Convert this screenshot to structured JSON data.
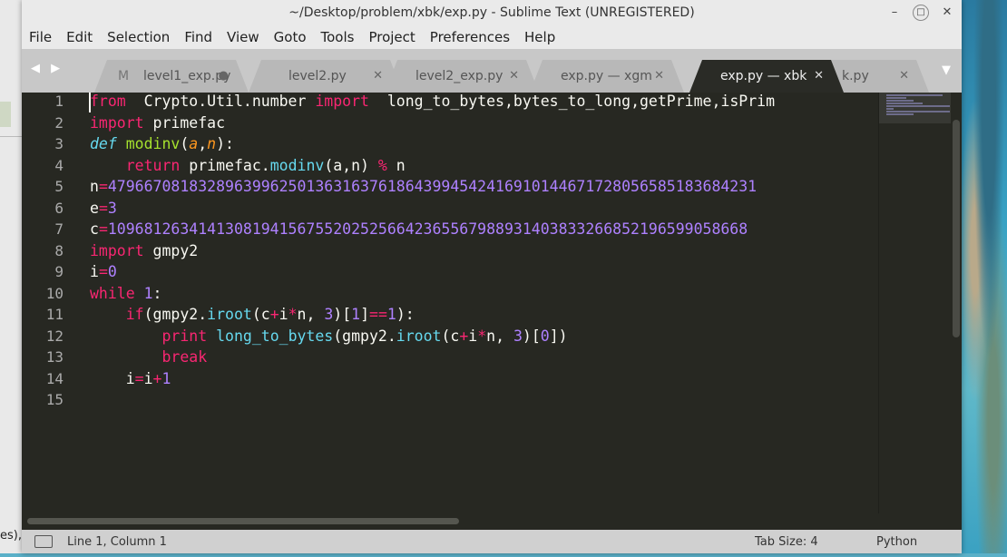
{
  "window": {
    "title": "~/Desktop/problem/xbk/exp.py - Sublime Text (UNREGISTERED)",
    "controls": {
      "minimize": "–",
      "maximize": "□",
      "close": "✕"
    }
  },
  "menu": [
    "File",
    "Edit",
    "Selection",
    "Find",
    "View",
    "Goto",
    "Tools",
    "Project",
    "Preferences",
    "Help"
  ],
  "tabs": {
    "nav": "◀ ▶",
    "overflow": "▼",
    "items": [
      {
        "label": "level1_exp.py",
        "close": "●",
        "prefix": "M"
      },
      {
        "label": "level2.py",
        "close": "✕"
      },
      {
        "label": "level2_exp.py",
        "close": "✕"
      },
      {
        "label": "exp.py — xgm",
        "close": "✕"
      },
      {
        "label": "exp.py — xbk",
        "close": "✕",
        "active": true
      },
      {
        "label": "k.py",
        "close": "✕"
      }
    ]
  },
  "editor": {
    "line_numbers": [
      "1",
      "2",
      "3",
      "4",
      "5",
      "6",
      "7",
      "8",
      "9",
      "10",
      "11",
      "12",
      "13",
      "14",
      "15"
    ],
    "lines": [
      [
        [
          "kw",
          "from"
        ],
        [
          "",
          "  Crypto.Util.number "
        ],
        [
          "kw",
          "import"
        ],
        [
          "",
          "  long_to_bytes,bytes_to_long,getPrime,isPrim"
        ]
      ],
      [
        [
          "kw",
          "import"
        ],
        [
          "",
          " primefac"
        ]
      ],
      [
        [
          "sf",
          "def"
        ],
        [
          "",
          " "
        ],
        [
          "fn",
          "modinv"
        ],
        [
          "",
          "("
        ],
        [
          "pa",
          "a"
        ],
        [
          "",
          ","
        ],
        [
          "pa",
          "n"
        ],
        [
          "",
          "):"
        ]
      ],
      [
        [
          "",
          "    "
        ],
        [
          "kw",
          "return"
        ],
        [
          "",
          " primefac."
        ],
        [
          "bf",
          "modinv"
        ],
        [
          "",
          "(a,n) "
        ],
        [
          "op",
          "%"
        ],
        [
          "",
          " n"
        ]
      ],
      [
        [
          "",
          "n"
        ],
        [
          "op",
          "="
        ],
        [
          "nu",
          "479667081832896399625013631637618643994542416910144671728056585183684231"
        ]
      ],
      [
        [
          "",
          "e"
        ],
        [
          "op",
          "="
        ],
        [
          "nu",
          "3"
        ]
      ],
      [
        [
          "",
          "c"
        ],
        [
          "op",
          "="
        ],
        [
          "nu",
          "10968126341413081941567552025256642365567988931403833266852196599058668"
        ]
      ],
      [
        [
          "kw",
          "import"
        ],
        [
          "",
          " gmpy2"
        ]
      ],
      [
        [
          "",
          "i"
        ],
        [
          "op",
          "="
        ],
        [
          "nu",
          "0"
        ]
      ],
      [
        [
          "kw",
          "while"
        ],
        [
          "",
          " "
        ],
        [
          "nu",
          "1"
        ],
        [
          "",
          ":"
        ]
      ],
      [
        [
          "",
          "    "
        ],
        [
          "kw",
          "if"
        ],
        [
          "",
          "(gmpy2."
        ],
        [
          "bf",
          "iroot"
        ],
        [
          "",
          "(c"
        ],
        [
          "op",
          "+"
        ],
        [
          "",
          "i"
        ],
        [
          "op",
          "*"
        ],
        [
          "",
          "n, "
        ],
        [
          "nu",
          "3"
        ],
        [
          "",
          ")["
        ],
        [
          "nu",
          "1"
        ],
        [
          "",
          "]"
        ],
        [
          "op",
          "=="
        ],
        [
          "nu",
          "1"
        ],
        [
          "",
          "):"
        ]
      ],
      [
        [
          "",
          "        "
        ],
        [
          "kw",
          "print"
        ],
        [
          "",
          " "
        ],
        [
          "bf",
          "long_to_bytes"
        ],
        [
          "",
          "(gmpy2."
        ],
        [
          "bf",
          "iroot"
        ],
        [
          "",
          "(c"
        ],
        [
          "op",
          "+"
        ],
        [
          "",
          "i"
        ],
        [
          "op",
          "*"
        ],
        [
          "",
          "n, "
        ],
        [
          "nu",
          "3"
        ],
        [
          "",
          ")["
        ],
        [
          "nu",
          "0"
        ],
        [
          "",
          "])"
        ]
      ],
      [
        [
          "",
          "        "
        ],
        [
          "kw",
          "break"
        ]
      ],
      [
        [
          "",
          "    i"
        ],
        [
          "op",
          "="
        ],
        [
          "",
          "i"
        ],
        [
          "op",
          "+"
        ],
        [
          "nu",
          "1"
        ]
      ],
      [
        [
          "",
          ""
        ]
      ]
    ]
  },
  "status": {
    "position": "Line 1, Column 1",
    "tab_size": "Tab Size: 4",
    "syntax": "Python"
  },
  "desktop": {
    "left_fragment": "es),",
    "left_fragment2": ""
  },
  "colors": {
    "editor_bg": "#272822",
    "keyword": "#f92672",
    "function": "#a6e22e",
    "number": "#ae81ff",
    "builtin": "#66d9ef",
    "param": "#fd971f",
    "text": "#f8f8f2"
  }
}
